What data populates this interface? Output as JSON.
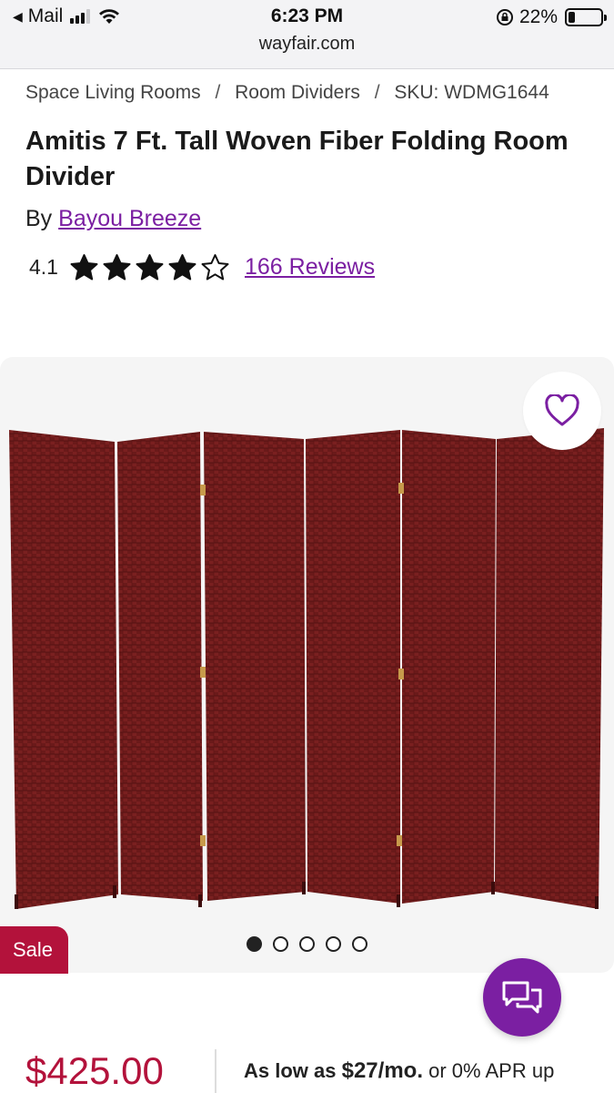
{
  "status_bar": {
    "back_app": "Mail",
    "time": "6:23 PM",
    "url": "wayfair.com",
    "battery": "22%",
    "battery_level": 0.22,
    "signal_bars_on": 3,
    "signal_bars_total": 4
  },
  "breadcrumb": {
    "items": [
      "Space Living Rooms",
      "Room Dividers"
    ],
    "sku": "SKU: WDMG1644",
    "separator": "/"
  },
  "product": {
    "title": "Amitis 7 Ft. Tall Woven Fiber Folding Room Divider",
    "by_prefix": "By",
    "brand": "Bayou Breeze",
    "rating": "4.1",
    "rating_value": 4.1,
    "stars_total": 5,
    "reviews_link": "166 Reviews"
  },
  "gallery": {
    "image_count": 5,
    "active_index": 0,
    "panel_color": "#6b1a1a",
    "favorite_icon": "heart-outline-icon"
  },
  "sale_badge": "Sale",
  "chat_icon": "chat-bubbles-icon",
  "pricing": {
    "price": "$425.00",
    "financing_prefix": "As low as",
    "financing_amount": "$27/mo.",
    "financing_suffix": "or 0% APR up"
  },
  "colors": {
    "accent_purple": "#7b1fa2",
    "sale_red": "#b3123b"
  }
}
